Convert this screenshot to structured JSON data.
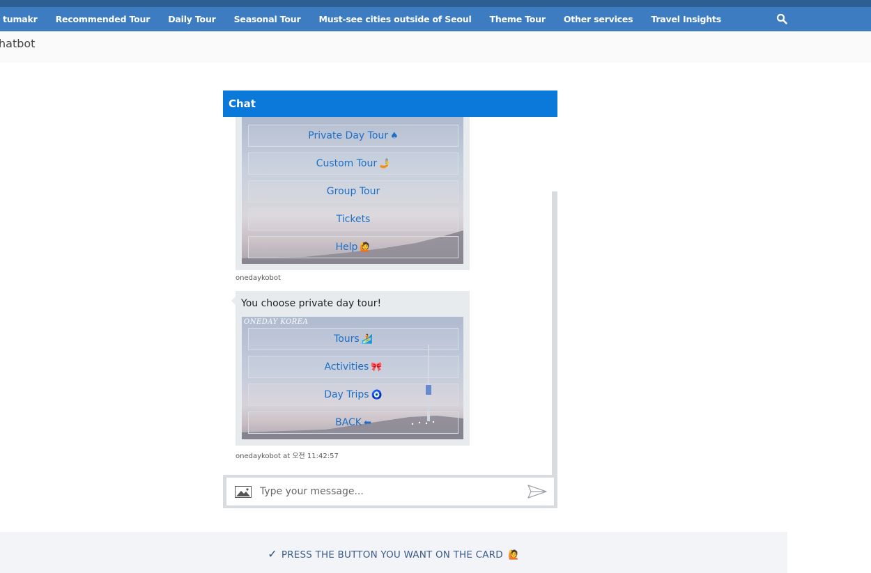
{
  "nav": {
    "items": [
      {
        "label": "tumakr"
      },
      {
        "label": "Recommended Tour"
      },
      {
        "label": "Daily Tour"
      },
      {
        "label": "Seasonal Tour"
      },
      {
        "label": "Must-see cities outside of Seoul"
      },
      {
        "label": "Theme Tour"
      },
      {
        "label": "Other services"
      },
      {
        "label": "Travel Insights"
      }
    ],
    "search_icon": "search-icon"
  },
  "page": {
    "title": "hatbot"
  },
  "chat": {
    "header_title": "Chat",
    "card1": {
      "buttons": [
        {
          "label": "Private Day Tour",
          "emoji": "♠"
        },
        {
          "label": "Custom Tour",
          "emoji": "🤳"
        },
        {
          "label": "Group Tour",
          "emoji": ""
        },
        {
          "label": "Tickets",
          "emoji": ""
        },
        {
          "label": "Help",
          "emoji": "🙋"
        }
      ],
      "meta": "onedaykobot"
    },
    "card2": {
      "text": "You choose private day tour!",
      "watermark": "ONEDAY KOREA",
      "buttons": [
        {
          "label": "Tours",
          "emoji": "🏄"
        },
        {
          "label": "Activities",
          "emoji": "🎀"
        },
        {
          "label": "Day Trips",
          "emoji": "🧿"
        },
        {
          "label": "BACK",
          "emoji": "⬅"
        }
      ],
      "meta": "onedaykobot at 오전 11:42:57"
    },
    "input": {
      "placeholder": "Type your message...",
      "image_icon": "image-icon",
      "send_icon": "send-icon"
    }
  },
  "banner": {
    "check": "✓",
    "text": "PRESS THE BUTTON YOU WANT ON THE CARD",
    "emoji": "🙋"
  }
}
